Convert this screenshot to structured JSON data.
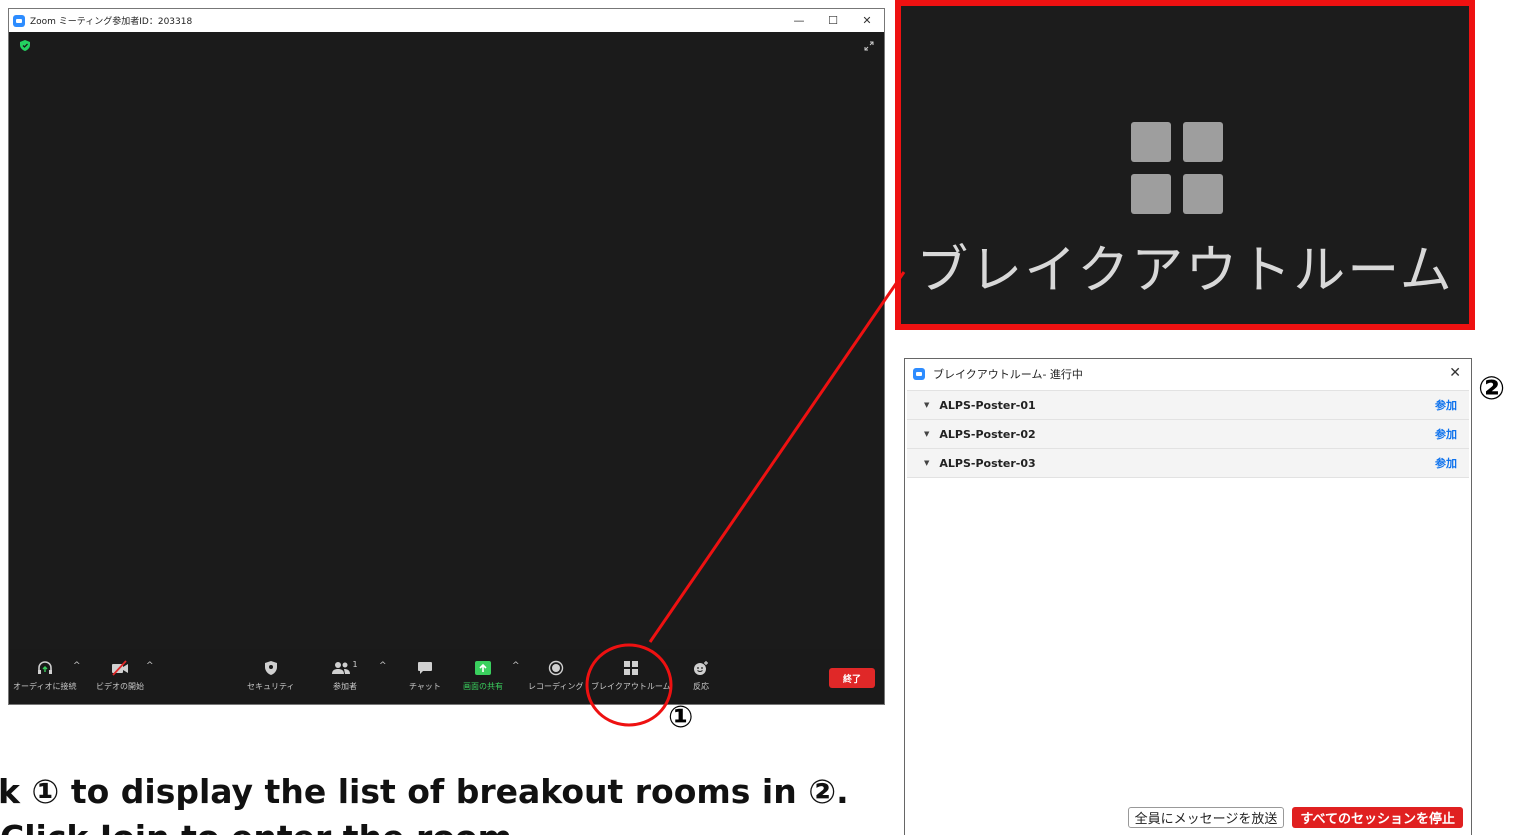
{
  "zoom_window": {
    "title": "Zoom ミーティング参加者ID：203318",
    "controls": {
      "minimize": "—",
      "maximize": "☐",
      "close": "✕"
    },
    "toolbar": {
      "audio_label": "オーディオに接続",
      "video_label": "ビデオの開始",
      "security_label": "セキュリティ",
      "participants_label": "参加者",
      "participants_count": "1",
      "chat_label": "チャット",
      "share_label": "画面の共有",
      "record_label": "レコーディング",
      "breakout_label": "ブレイクアウトルーム",
      "reactions_label": "反応",
      "end_label": "終了",
      "caret": "^"
    },
    "colors": {
      "share_accent": "#3ad05e",
      "end_button": "#e02828"
    }
  },
  "annotations": {
    "marker_1": "①",
    "marker_2": "②",
    "highlight_color": "#ee1111"
  },
  "zoom_inset": {
    "label": "ブレイクアウトルーム"
  },
  "breakout_panel": {
    "title": "ブレイクアウトルーム- 進行中",
    "close": "✕",
    "rooms": [
      {
        "name": "ALPS-Poster-01",
        "join": "参加"
      },
      {
        "name": "ALPS-Poster-02",
        "join": "参加"
      },
      {
        "name": "ALPS-Poster-03",
        "join": "参加"
      }
    ],
    "broadcast_button": "全員にメッセージを放送",
    "stop_all_button": "すべてのセッションを停止",
    "colors": {
      "join_link": "#0e72ed",
      "stop_button": "#e02020"
    }
  },
  "caption": {
    "line1": "k ① to display the list of breakout rooms in ②.",
    "line2": "Click Join to enter the room."
  }
}
